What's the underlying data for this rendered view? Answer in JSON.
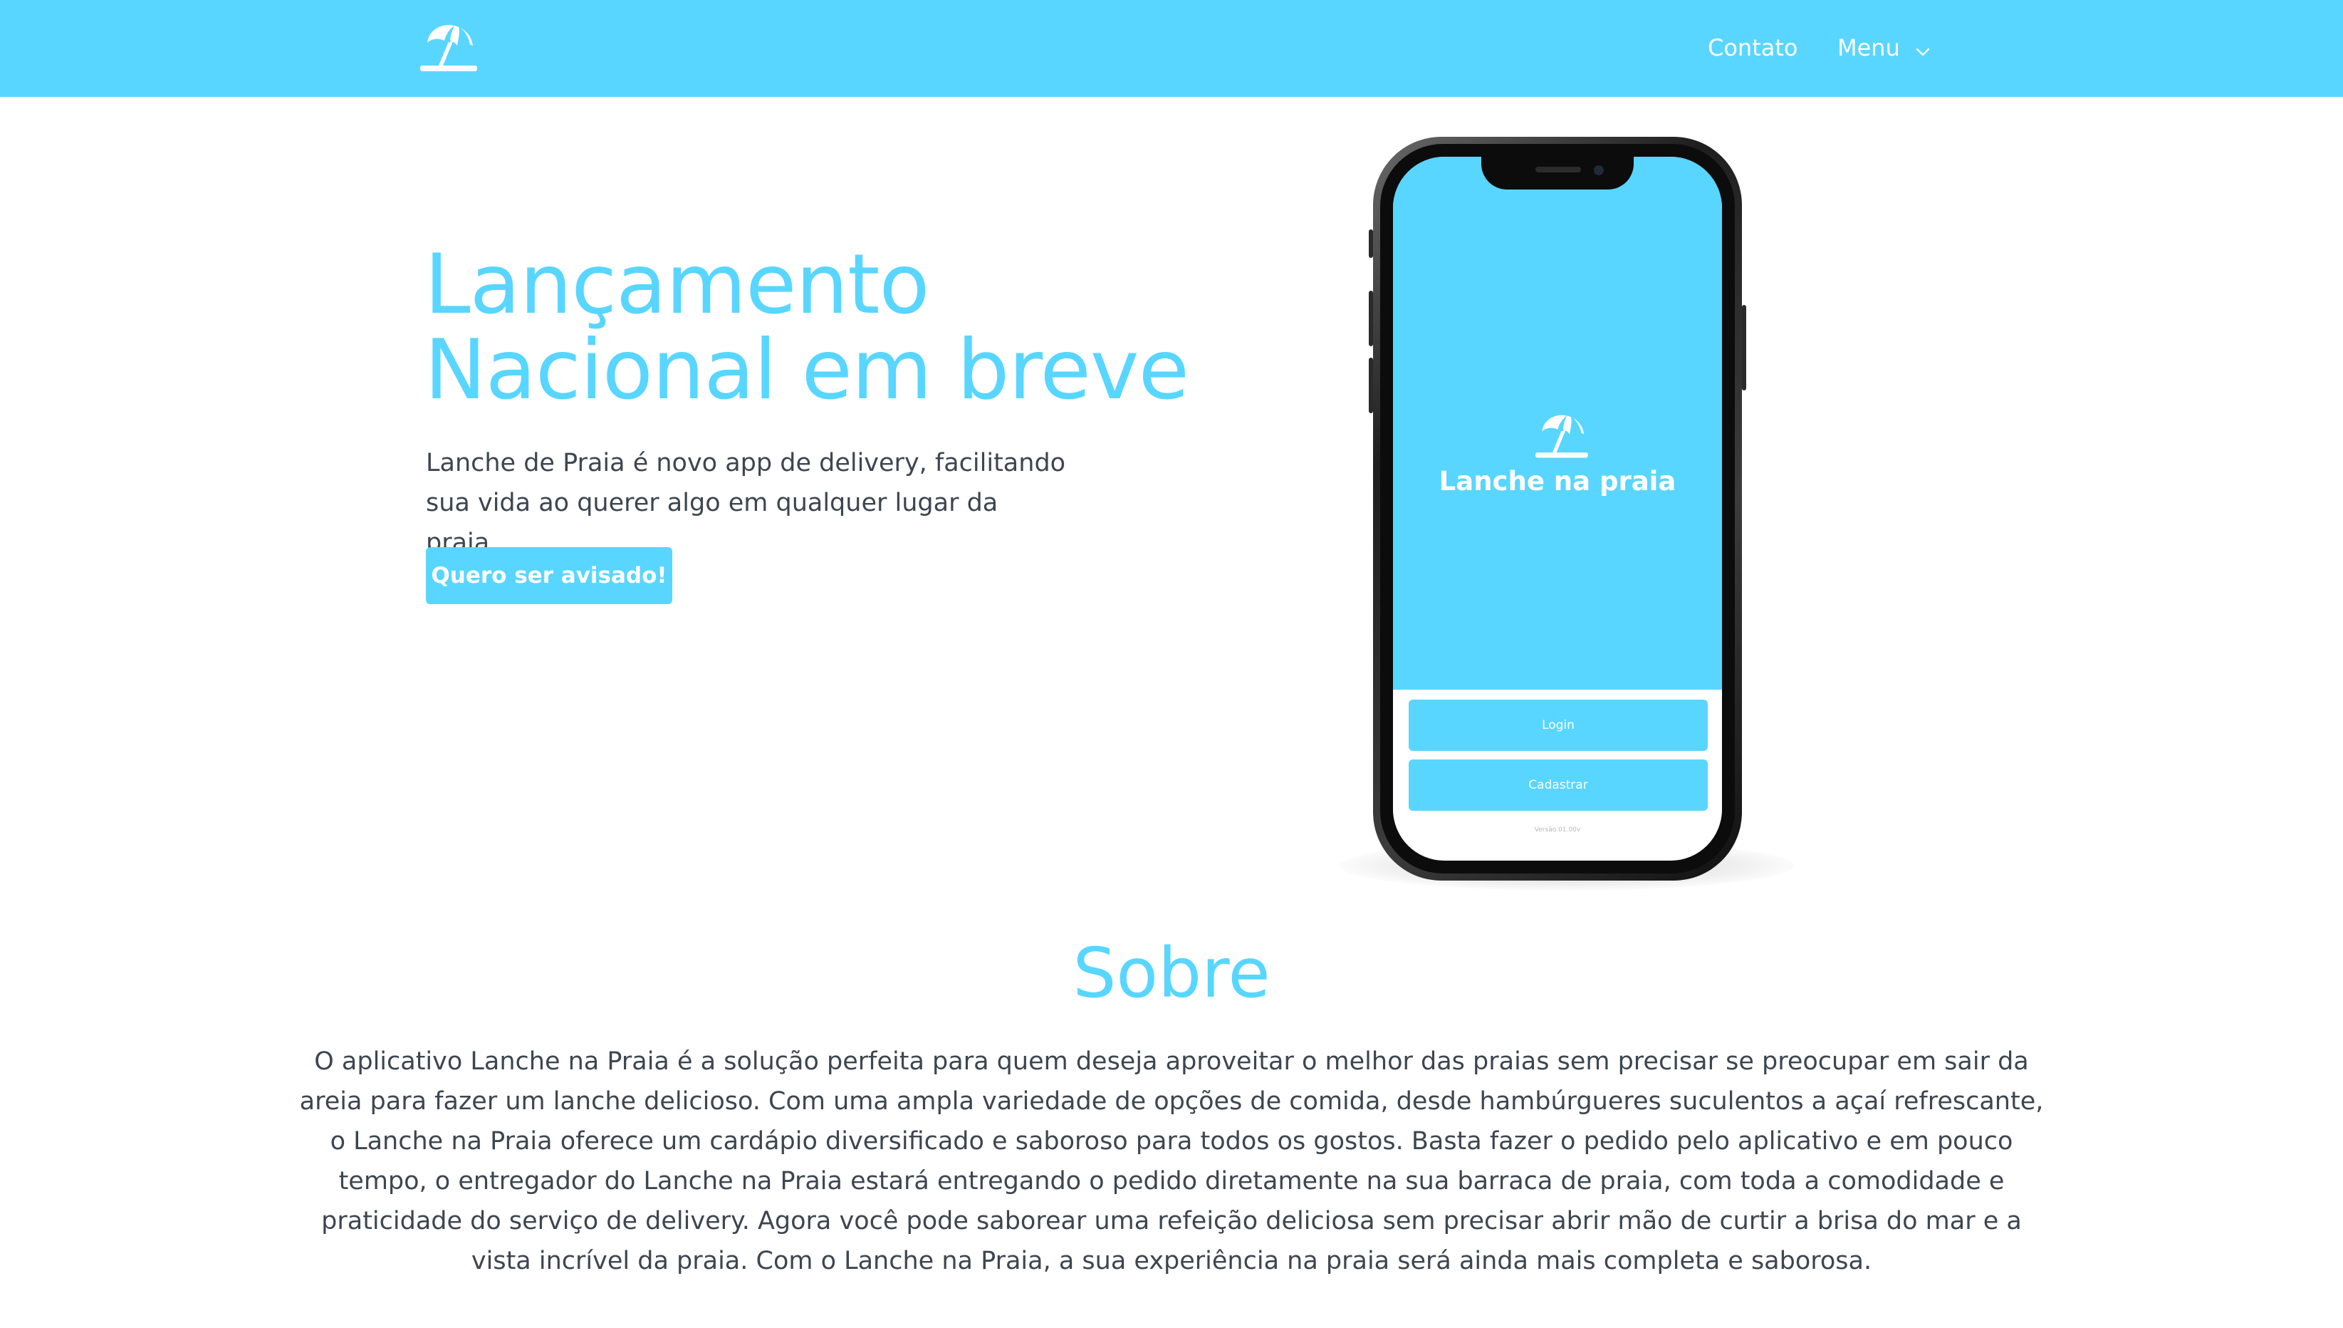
{
  "colors": {
    "accent": "#58d6ff",
    "text": "#3d4650",
    "white": "#ffffff"
  },
  "nav": {
    "logo_icon": "beach-umbrella-icon",
    "contato": "Contato",
    "menu": "Menu",
    "menu_icon": "chevron-down-icon"
  },
  "hero": {
    "title_line1": "Lançamento",
    "title_line2": "Nacional em breve",
    "description_line1": "Lanche de Praia é novo app de delivery, facilitando",
    "description_line2": "sua vida ao querer algo em qualquer lugar da praia.",
    "cta": "Quero ser avisado!"
  },
  "phone": {
    "app_logo_icon": "beach-umbrella-icon",
    "app_name": "Lanche na praia",
    "login": "Login",
    "cadastrar": "Cadastrar",
    "version": "Versão 01.00v"
  },
  "sobre": {
    "title": "Sobre",
    "text": "O aplicativo Lanche na Praia é a solução perfeita para quem deseja aproveitar o melhor das praias sem precisar se preocupar em sair da areia para fazer um lanche delicioso. Com uma ampla variedade de opções de comida, desde hambúrgueres suculentos a açaí refrescante, o Lanche na Praia oferece um cardápio diversificado e saboroso para todos os gostos. Basta fazer o pedido pelo aplicativo e em pouco tempo, o entregador do Lanche na Praia estará entregando o pedido diretamente na sua barraca de praia, com toda a comodidade e praticidade do serviço de delivery. Agora você pode saborear uma refeição deliciosa sem precisar abrir mão de curtir a brisa do mar e a vista incrível da praia. Com o Lanche na Praia, a sua experiência na praia será ainda mais completa e saborosa."
  }
}
